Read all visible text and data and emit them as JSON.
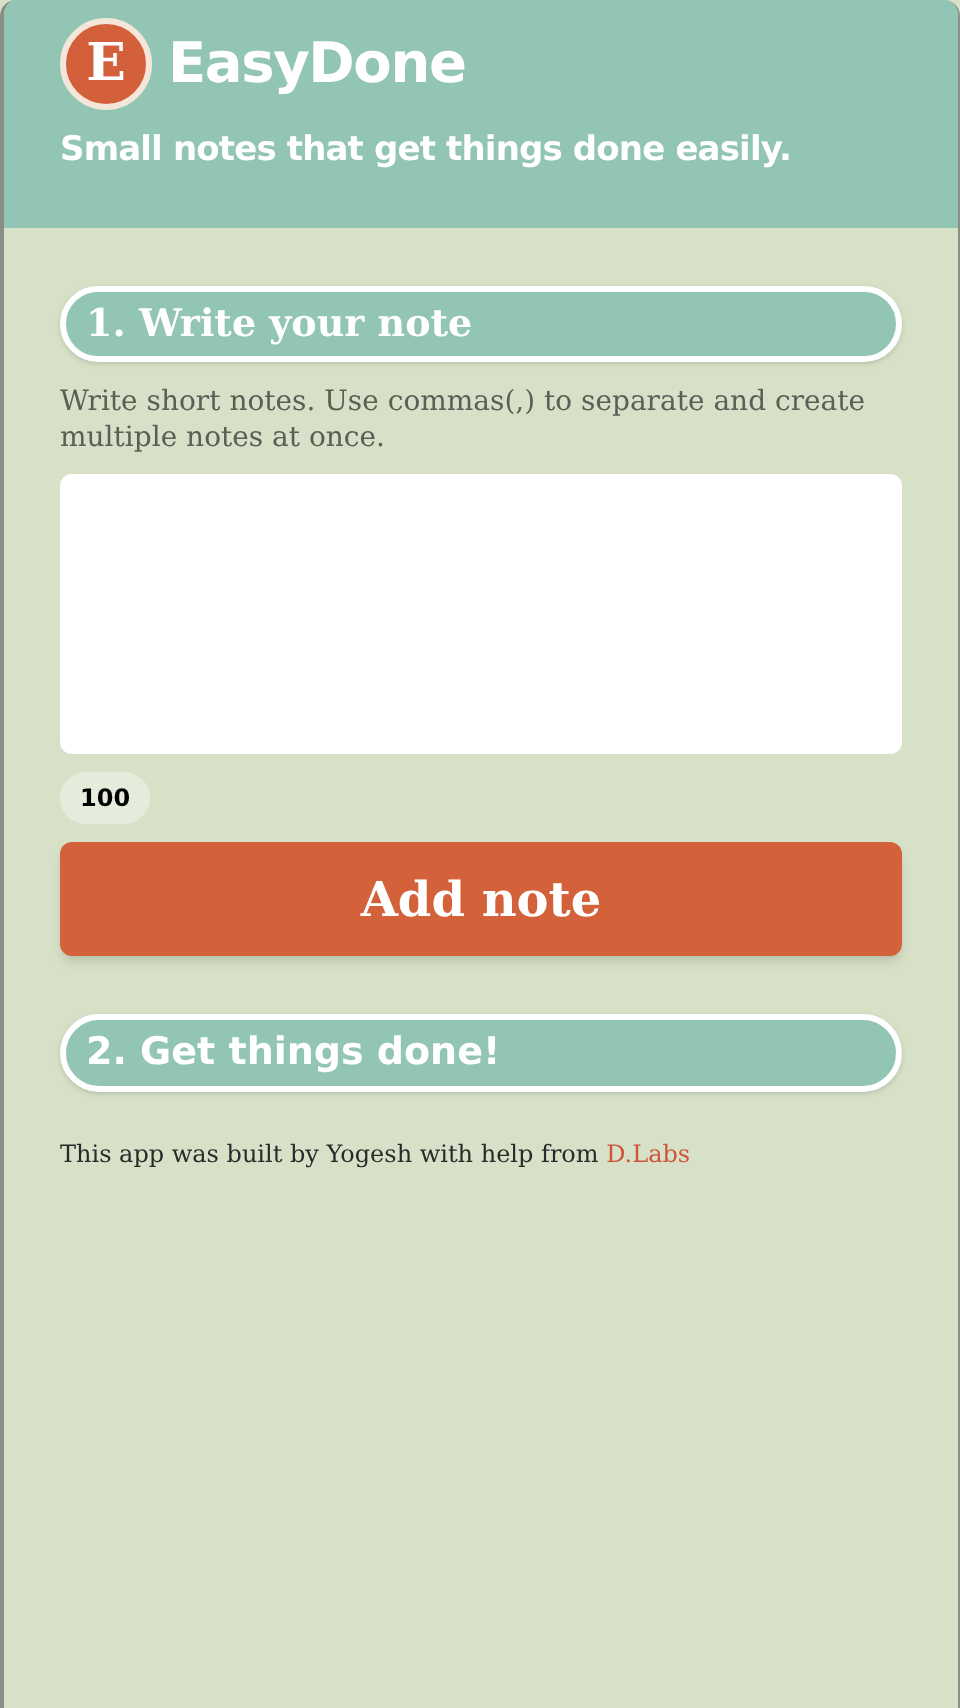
{
  "header": {
    "logo_letter": "E",
    "title": "EasyDone",
    "tagline": "Small notes that get things done easily."
  },
  "write_section": {
    "heading": "1. Write your note",
    "description": "Write short notes. Use commas(,) to separate and create multiple notes at once.",
    "char_count": "100",
    "button": "Add note"
  },
  "done_section": {
    "heading": "2. Get things done!"
  },
  "footer": {
    "text": "This app was built by Yogesh with help from ",
    "link": "D.Labs"
  }
}
